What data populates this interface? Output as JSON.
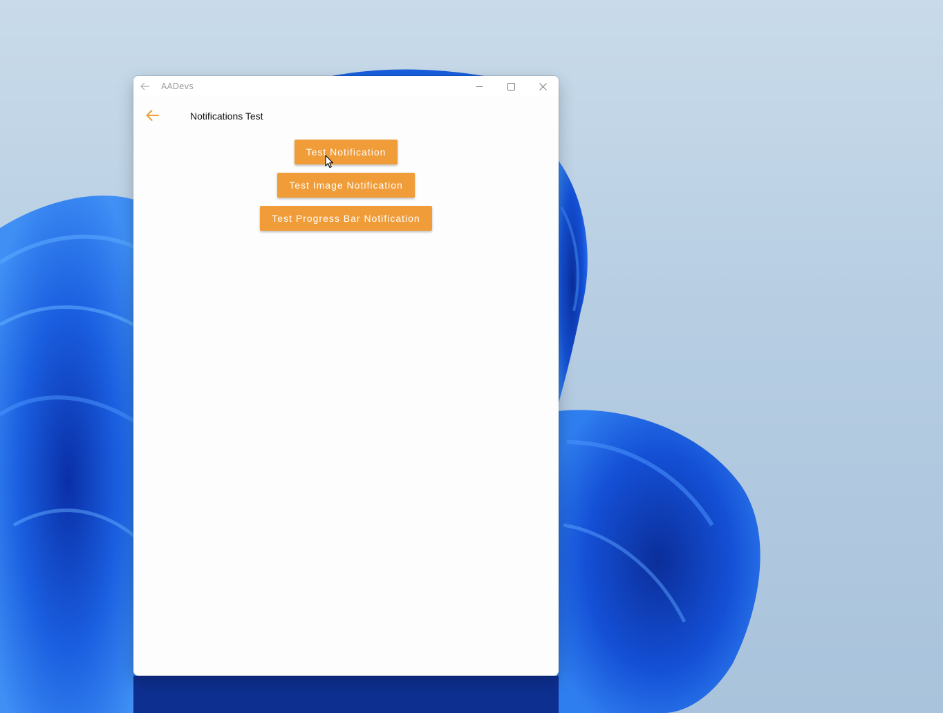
{
  "window": {
    "title": "AADevs"
  },
  "app_bar": {
    "title": "Notifications Test"
  },
  "buttons": {
    "test_notification": "Test Notification",
    "test_image_notification": "Test Image Notification",
    "test_progress_bar_notification": "Test Progress Bar Notification"
  },
  "colors": {
    "accent": "#f09c38",
    "window_background": "#fdfdfd"
  },
  "icons": {
    "titlebar_back": "arrow-left-icon",
    "app_back": "arrow-left-icon",
    "minimize": "minimize-icon",
    "maximize": "maximize-icon",
    "close": "close-icon",
    "cursor": "mouse-pointer-icon"
  }
}
